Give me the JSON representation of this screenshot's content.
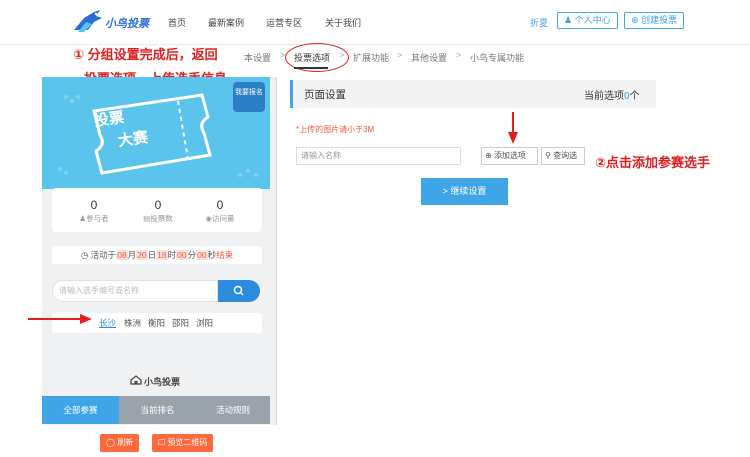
{
  "header": {
    "logo_text": "小鸟投票",
    "nav": [
      "首页",
      "最新案例",
      "运营专区",
      "关于我们"
    ],
    "user_name": "折夏",
    "user_center": "个人中心",
    "create_vote": "创建投票"
  },
  "breadcrumb": {
    "items": [
      "本设置",
      "投票选项",
      "扩展功能",
      "其他设置",
      "小鸟专属功能"
    ],
    "active": "投票选项"
  },
  "annotations": {
    "step1_line1": "① 分组设置完成后，返回",
    "step1_line2": "投票选项，上传选手信息",
    "step2": "②点击添加参赛选手"
  },
  "preview": {
    "banner_title_1": "投票",
    "banner_title_2": "大赛",
    "banner_button": "我要报名",
    "stats": [
      {
        "value": "0",
        "label": "参与者"
      },
      {
        "value": "0",
        "label": "投票数"
      },
      {
        "value": "0",
        "label": "访问量"
      }
    ],
    "timer": {
      "prefix": "活动于",
      "month": "08",
      "month_unit": "月",
      "day": "20",
      "day_unit": "日",
      "hour": "18",
      "hour_unit": "时",
      "minute": "00",
      "minute_unit": "分",
      "second": "00",
      "second_unit": "秒",
      "suffix": "结束"
    },
    "search_placeholder": "请输入选手编号或名称",
    "cities": [
      "长沙",
      "株洲",
      "衡阳",
      "邵阳",
      "浏阳"
    ],
    "selected_city": "长沙",
    "brand": "小鸟投票",
    "tabs": [
      "全部参赛",
      "当前排名",
      "活动规则"
    ],
    "refresh_button": "刷新",
    "preview_qr_button": "预览二维码"
  },
  "panel": {
    "title": "页面设置",
    "count_prefix": "当前选项",
    "count": "0",
    "count_suffix": "个",
    "hint": "*上传的图片请小于3M",
    "name_placeholder": "请输入名称",
    "add_option": "添加选项",
    "query": "查询选",
    "continue_button": "继续设置"
  },
  "colors": {
    "accent": "#3fa5e6",
    "annotation_red": "#e02020",
    "banner": "#5ac4ec",
    "orange": "#ff6a3d"
  }
}
